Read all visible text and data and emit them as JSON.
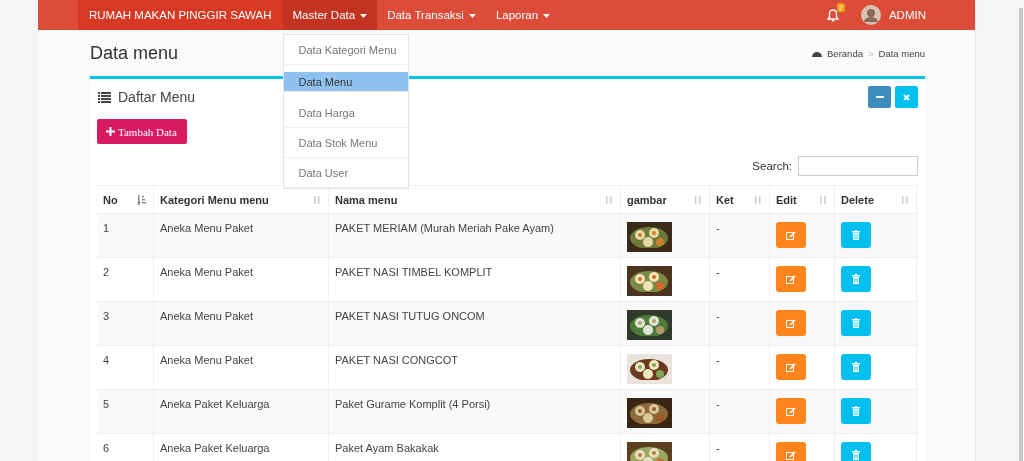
{
  "navbar": {
    "brand": "RUMAH MAKAN PINGGIR SAWAH",
    "menus": [
      {
        "label": "Master Data",
        "expanded": true
      },
      {
        "label": "Data Transaksi",
        "expanded": false
      },
      {
        "label": "Laporan",
        "expanded": false
      }
    ],
    "notification_count": "2",
    "user": "ADMIN"
  },
  "dropdown": {
    "items": [
      {
        "label": "Data Kategori Menu",
        "selected": false
      },
      {
        "label": "Data Menu",
        "selected": true
      },
      {
        "label": "Data Harga",
        "selected": false
      },
      {
        "label": "Data Stok Menu",
        "selected": false
      },
      {
        "label": "Data User",
        "selected": false
      }
    ]
  },
  "page": {
    "title": "Data menu",
    "breadcrumb": [
      "Beranda",
      "Data menu"
    ],
    "breadcrumb_separator": ">"
  },
  "box": {
    "title": "Daftar Menu",
    "add_button": "Tambah Data",
    "search": {
      "label": "Search:"
    }
  },
  "table": {
    "columns": [
      {
        "label": "No",
        "sorted": true
      },
      {
        "label": "Kategori Menu menu",
        "sorted": false
      },
      {
        "label": "Nama menu",
        "sorted": false
      },
      {
        "label": "gambar",
        "sorted": false
      },
      {
        "label": "Ket",
        "sorted": false
      },
      {
        "label": "Edit",
        "sorted": false
      },
      {
        "label": "Delete",
        "sorted": false
      }
    ],
    "rows": [
      {
        "no": "1",
        "kategori": "Aneka Menu Paket",
        "nama": "PAKET MERIAM (Murah Meriah Pake Ayam)",
        "ket": "-"
      },
      {
        "no": "2",
        "kategori": "Aneka Menu Paket",
        "nama": "PAKET NASI TIMBEL KOMPLIT",
        "ket": "-"
      },
      {
        "no": "3",
        "kategori": "Aneka Menu Paket",
        "nama": "PAKET NASI TUTUG ONCOM",
        "ket": "-"
      },
      {
        "no": "4",
        "kategori": "Aneka Menu Paket",
        "nama": "PAKET NASI CONGCOT",
        "ket": "-"
      },
      {
        "no": "5",
        "kategori": "Aneka Paket Keluarga",
        "nama": "Paket Gurame Komplit (4 Porsi)",
        "ket": "-"
      },
      {
        "no": "6",
        "kategori": "Aneka Paket Keluarga",
        "nama": "Paket Ayam Bakakak",
        "ket": "-"
      }
    ]
  }
}
